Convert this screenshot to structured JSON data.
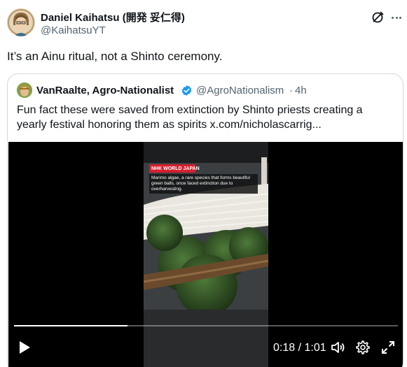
{
  "tweet": {
    "author_name": "Daniel Kaihatsu (開発 妥仁得)",
    "author_handle": "@KaihatsuYT",
    "text": "It’s an Ainu ritual, not a Shinto ceremony.",
    "icons": {
      "grok": "grok-icon",
      "more": "more-icon"
    }
  },
  "quote": {
    "author_name": "VanRaalte, Agro-Nationalist",
    "author_handle": "@AgroNationalism",
    "separator": "·",
    "time": "4h",
    "text": "Fun fact these were saved from extinction by Shinto priests creating a yearly festival honoring them as spirits ",
    "link": "x.com/nicholascarrig...",
    "verified_color": "#1d9bf0",
    "video": {
      "badge": "NHK WORLD JAPAN",
      "caption": "Marimo algae, a rare species that forms beautiful green balls, once faced extinction due to overharvesting.",
      "time": "0:18 / 1:01",
      "progress_fraction": 0.295,
      "icons": [
        "play-icon",
        "volume-icon",
        "settings-gear-icon",
        "fullscreen-icon"
      ]
    }
  }
}
